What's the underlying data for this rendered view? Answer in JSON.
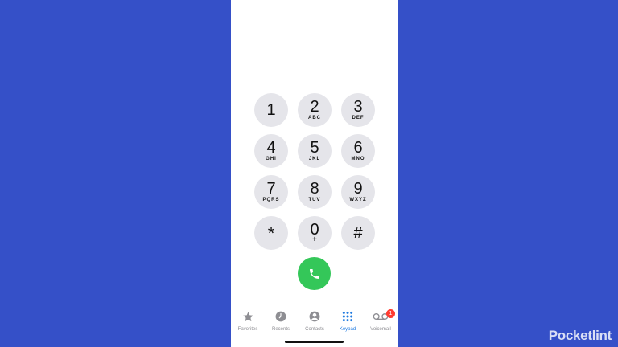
{
  "colors": {
    "background": "#3550c8",
    "key_fill": "#e5e5ea",
    "call_button": "#34c759",
    "active_tab": "#1f7ae0",
    "inactive_tab": "#8e8e93",
    "badge": "#ff3b30"
  },
  "keys": [
    {
      "digit": "1",
      "letters": ""
    },
    {
      "digit": "2",
      "letters": "ABC"
    },
    {
      "digit": "3",
      "letters": "DEF"
    },
    {
      "digit": "4",
      "letters": "GHI"
    },
    {
      "digit": "5",
      "letters": "JKL"
    },
    {
      "digit": "6",
      "letters": "MNO"
    },
    {
      "digit": "7",
      "letters": "PQRS"
    },
    {
      "digit": "8",
      "letters": "TUV"
    },
    {
      "digit": "9",
      "letters": "WXYZ"
    },
    {
      "digit": "*",
      "letters": ""
    },
    {
      "digit": "0",
      "letters": "+"
    },
    {
      "digit": "#",
      "letters": ""
    }
  ],
  "call_button": {
    "icon": "phone-icon"
  },
  "tabbar": {
    "favorites": {
      "label": "Favorites",
      "icon": "star-icon"
    },
    "recents": {
      "label": "Recents",
      "icon": "clock-icon"
    },
    "contacts": {
      "label": "Contacts",
      "icon": "person-icon"
    },
    "keypad": {
      "label": "Keypad",
      "icon": "keypad-grid-icon"
    },
    "voicemail": {
      "label": "Voicemail",
      "icon": "voicemail-icon",
      "badge": "1"
    }
  },
  "watermark": "Pocketlint"
}
